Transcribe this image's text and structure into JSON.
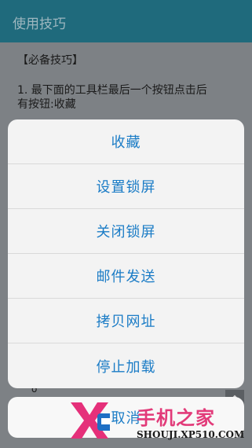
{
  "titlebar": {
    "title": "使用技巧"
  },
  "page": {
    "section_header": "【必备技巧】",
    "tip_line1": "1. 最下面的工具栏最后一个按钮点击后",
    "tip_line2": "有按钮:收藏",
    "stray_char": "o"
  },
  "action_sheet": {
    "items": [
      {
        "label": "收藏"
      },
      {
        "label": "设置锁屏"
      },
      {
        "label": "关闭锁屏"
      },
      {
        "label": "邮件发送"
      },
      {
        "label": "拷贝网址"
      },
      {
        "label": "停止加载"
      }
    ],
    "cancel_label": "取消"
  },
  "watermark": {
    "brand": "手机之家",
    "site": "SHOUJI.XP510.COM"
  },
  "colors": {
    "titlebar": "#1f6a7c",
    "accent": "#1b7cc6",
    "brand": "#e23a79"
  }
}
